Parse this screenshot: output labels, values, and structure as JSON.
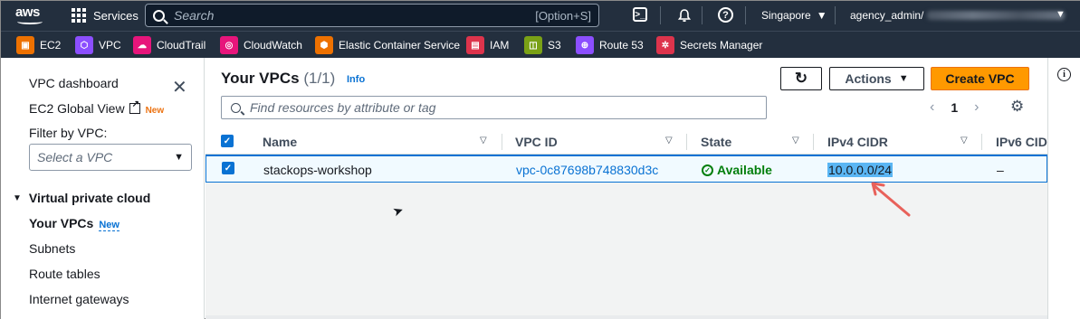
{
  "topnav": {
    "logo_text": "aws",
    "services_label": "Services",
    "search_placeholder": "Search",
    "search_shortcut": "[Option+S]",
    "cloudshell_glyph": ">_",
    "help_glyph": "?",
    "region": "Singapore",
    "account": "agency_admin/"
  },
  "favorites": [
    {
      "label": "EC2",
      "icon": "ec2-icon",
      "color": "#ed7100",
      "glyph": "▣"
    },
    {
      "label": "VPC",
      "icon": "vpc-icon",
      "color": "#8c4fff",
      "glyph": "⬡"
    },
    {
      "label": "CloudTrail",
      "icon": "cloudtrail-icon",
      "color": "#e7157b",
      "glyph": "☁"
    },
    {
      "label": "CloudWatch",
      "icon": "cloudwatch-icon",
      "color": "#e7157b",
      "glyph": "◎"
    },
    {
      "label": "Elastic Container Service",
      "icon": "ecs-icon",
      "color": "#ed7100",
      "glyph": "⬢"
    },
    {
      "label": "IAM",
      "icon": "iam-icon",
      "color": "#dd344c",
      "glyph": "▤"
    },
    {
      "label": "S3",
      "icon": "s3-icon",
      "color": "#7aa116",
      "glyph": "◫"
    },
    {
      "label": "Route 53",
      "icon": "route53-icon",
      "color": "#8c4fff",
      "glyph": "⊕"
    },
    {
      "label": "Secrets Manager",
      "icon": "secrets-manager-icon",
      "color": "#dd344c",
      "glyph": "✲"
    }
  ],
  "sidebar": {
    "dashboard": "VPC dashboard",
    "global_view": "EC2 Global View",
    "global_view_badge": "New",
    "filter_label": "Filter by VPC:",
    "filter_placeholder": "Select a VPC",
    "section": "Virtual private cloud",
    "items": [
      {
        "label": "Your VPCs",
        "badge": "New",
        "active": true
      },
      {
        "label": "Subnets"
      },
      {
        "label": "Route tables"
      },
      {
        "label": "Internet gateways"
      }
    ]
  },
  "main": {
    "title": "Your VPCs",
    "count": "(1/1)",
    "info": "Info",
    "refresh_glyph": "↻",
    "actions_label": "Actions",
    "create_label": "Create VPC",
    "search_placeholder": "Find resources by attribute or tag",
    "page": "1",
    "columns": [
      "Name",
      "VPC ID",
      "State",
      "IPv4 CIDR",
      "IPv6 CIDR"
    ],
    "rows": [
      {
        "name": "stackops-workshop",
        "vpc_id": "vpc-0c87698b748830d3c",
        "state": "Available",
        "ipv4_cidr": "10.0.0.0/24",
        "ipv6_cidr": "–",
        "selected": true
      }
    ]
  },
  "colors": {
    "nav_bg": "#232f3e",
    "primary_button": "#ff9900",
    "link": "#0972d3",
    "success": "#037f0c",
    "selection_highlight": "#5ab6f4",
    "annotation_arrow": "#e8615a"
  }
}
